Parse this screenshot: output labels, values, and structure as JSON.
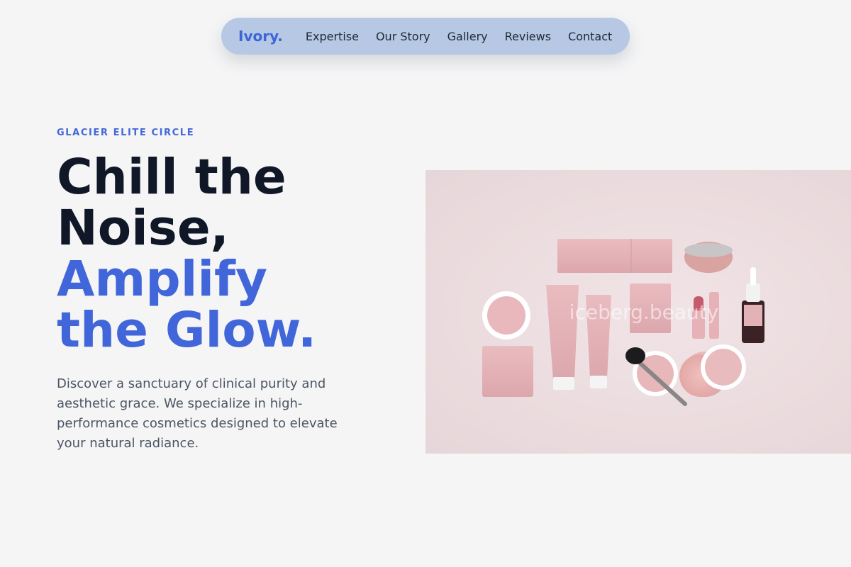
{
  "nav": {
    "brand": "Ivory.",
    "links": [
      "Expertise",
      "Our Story",
      "Gallery",
      "Reviews",
      "Contact"
    ]
  },
  "hero": {
    "eyebrow": "GLACIER ELITE CIRCLE",
    "headline_lines": [
      "Chill the",
      "Noise,"
    ],
    "headline_accent_lines": [
      "Amplify",
      "the Glow."
    ],
    "description": "Discover a sanctuary of clinical purity and aesthetic grace. We specialize in high-performance cosmetics designed to elevate your natural radiance.",
    "image_watermark": "iceberg.beauty"
  },
  "colors": {
    "background": "#f5f5f6",
    "nav_background": "#b6c8e3",
    "accent": "#4066da",
    "heading": "#101828",
    "body_text": "#4b5563"
  }
}
